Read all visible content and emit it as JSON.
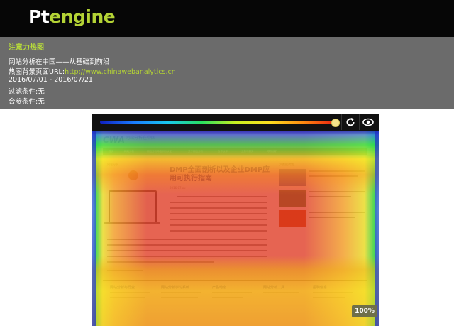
{
  "logo": {
    "part1": "Pt",
    "part2": "engine"
  },
  "info": {
    "title": "注意力热图",
    "site_name": "网站分析在中国——从基础到前沿",
    "bg_label": "热图背景页面URL:",
    "bg_url": "http://www.chinawebanalytics.cn",
    "date_range": "2016/07/01 - 2016/07/21",
    "filter": "过滤条件:无",
    "join": "合参条件:无"
  },
  "viewer": {
    "zoom": "100%",
    "threshold_fraction": 0.99
  },
  "site": {
    "logo": "CWA",
    "name": "网站分析在中国",
    "subtitle": "",
    "nav": [
      "首页",
      "网站分析",
      "网站分析师培训与认证",
      "关于网站分析",
      "合作伙伴",
      "业务与服务",
      "联系我们"
    ],
    "left_label": "网站分析",
    "article_title": "DMP全面剖析以及企业DMP应用可执行指南",
    "article_meta": "2016.07.xx",
    "right_label": "大数据/专题",
    "footer": [
      "网站分析与行业",
      "网站分析学习系统",
      "产品动态",
      "网站分析工具",
      "招聘信息"
    ]
  },
  "colors": {
    "topbar": "#060606",
    "infobar": "#6b6b6b",
    "accent": "#b4d335",
    "heat_hot": "#e12d14",
    "heat_warm": "#f59614",
    "heat_mid": "#ebdc1e",
    "heat_cool": "#28d23c",
    "heat_cold": "#1420c8"
  }
}
